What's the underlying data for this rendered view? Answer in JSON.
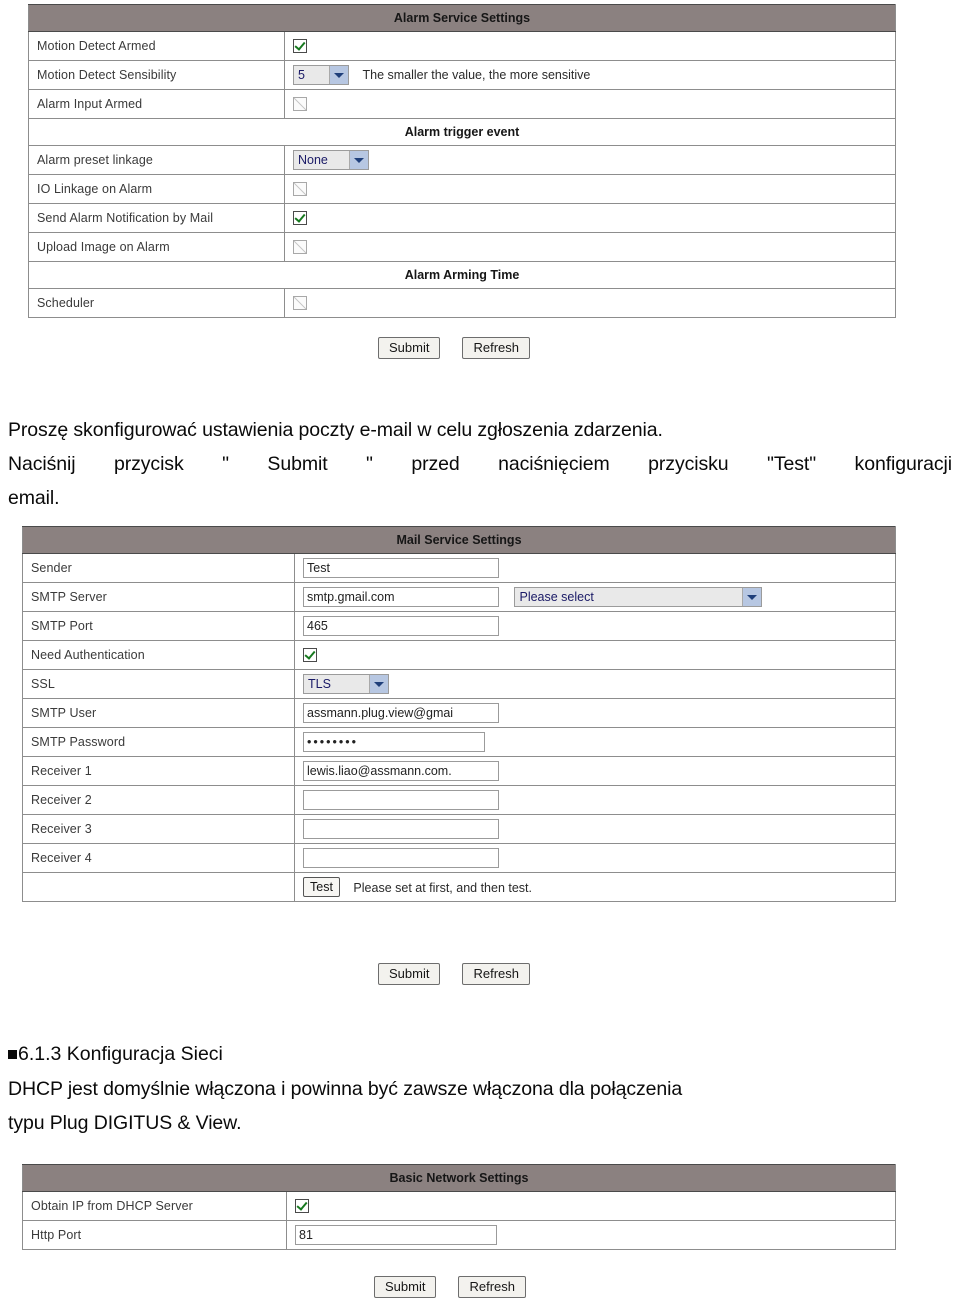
{
  "alarm_table": {
    "title": "Alarm Service Settings",
    "rows": [
      {
        "type": "checkbox",
        "label": "Motion Detect Armed",
        "checked": true
      },
      {
        "type": "select_hint",
        "label": "Motion Detect Sensibility",
        "value": "5",
        "hint": "The smaller the value, the more sensitive"
      },
      {
        "type": "checkbox",
        "label": "Alarm Input Armed",
        "checked": false
      },
      {
        "type": "subsection",
        "label": "Alarm trigger event"
      },
      {
        "type": "select",
        "label": "Alarm preset linkage",
        "value": "None"
      },
      {
        "type": "checkbox",
        "label": "IO Linkage on Alarm",
        "checked": false
      },
      {
        "type": "checkbox",
        "label": "Send Alarm Notification by Mail",
        "checked": true
      },
      {
        "type": "checkbox",
        "label": "Upload Image on Alarm",
        "checked": false
      },
      {
        "type": "subsection",
        "label": "Alarm Arming Time"
      },
      {
        "type": "checkbox",
        "label": "Scheduler",
        "checked": false
      }
    ],
    "buttons": {
      "submit": "Submit",
      "refresh": "Refresh"
    }
  },
  "body_text": {
    "line1": "Proszę skonfigurować ustawienia poczty e-mail w celu zgłoszenia zdarzenia.",
    "line2": "Naciśnij przycisk \" Submit \" przed naciśnięciem przycisku \"Test\" konfiguracji",
    "line3": "email."
  },
  "mail_table": {
    "title": "Mail Service Settings",
    "rows": [
      {
        "type": "text",
        "label": "Sender",
        "value": "Test"
      },
      {
        "type": "text_select",
        "label": "SMTP Server",
        "value": "smtp.gmail.com",
        "select_value": "Please select"
      },
      {
        "type": "text",
        "label": "SMTP Port",
        "value": "465"
      },
      {
        "type": "checkbox",
        "label": "Need Authentication",
        "checked": true
      },
      {
        "type": "select",
        "label": "SSL",
        "value": "TLS"
      },
      {
        "type": "text",
        "label": "SMTP User",
        "value": "assmann.plug.view@gmai"
      },
      {
        "type": "password",
        "label": "SMTP Password",
        "value": "••••••••"
      },
      {
        "type": "text",
        "label": "Receiver 1",
        "value": "lewis.liao@assmann.com."
      },
      {
        "type": "text",
        "label": "Receiver 2",
        "value": ""
      },
      {
        "type": "text",
        "label": "Receiver 3",
        "value": ""
      },
      {
        "type": "text",
        "label": "Receiver 4",
        "value": ""
      },
      {
        "type": "test",
        "label": "",
        "button": "Test",
        "hint": "Please set at first, and then test."
      }
    ],
    "buttons": {
      "submit": "Submit",
      "refresh": "Refresh"
    }
  },
  "section_heading": {
    "number": "6.1.3",
    "title": "Konfiguracja Sieci",
    "full": "6.1.3 Konfiguracja Sieci"
  },
  "network_text": {
    "line1": "DHCP jest domyślnie włączona i powinna być zawsze włączona dla połączenia",
    "line2": "typu Plug DIGITUS & View."
  },
  "network_table": {
    "title": "Basic Network Settings",
    "rows": [
      {
        "type": "checkbox",
        "label": "Obtain IP from DHCP Server",
        "checked": true
      },
      {
        "type": "text",
        "label": "Http Port",
        "value": "81"
      }
    ],
    "buttons": {
      "submit": "Submit",
      "refresh": "Refresh"
    }
  },
  "colors": {
    "section_header_bg": "#8b8180",
    "table_border": "#4a4a4a",
    "checkbox_check": "#17791f",
    "select_arrow_bg": "#b7c7e2"
  }
}
